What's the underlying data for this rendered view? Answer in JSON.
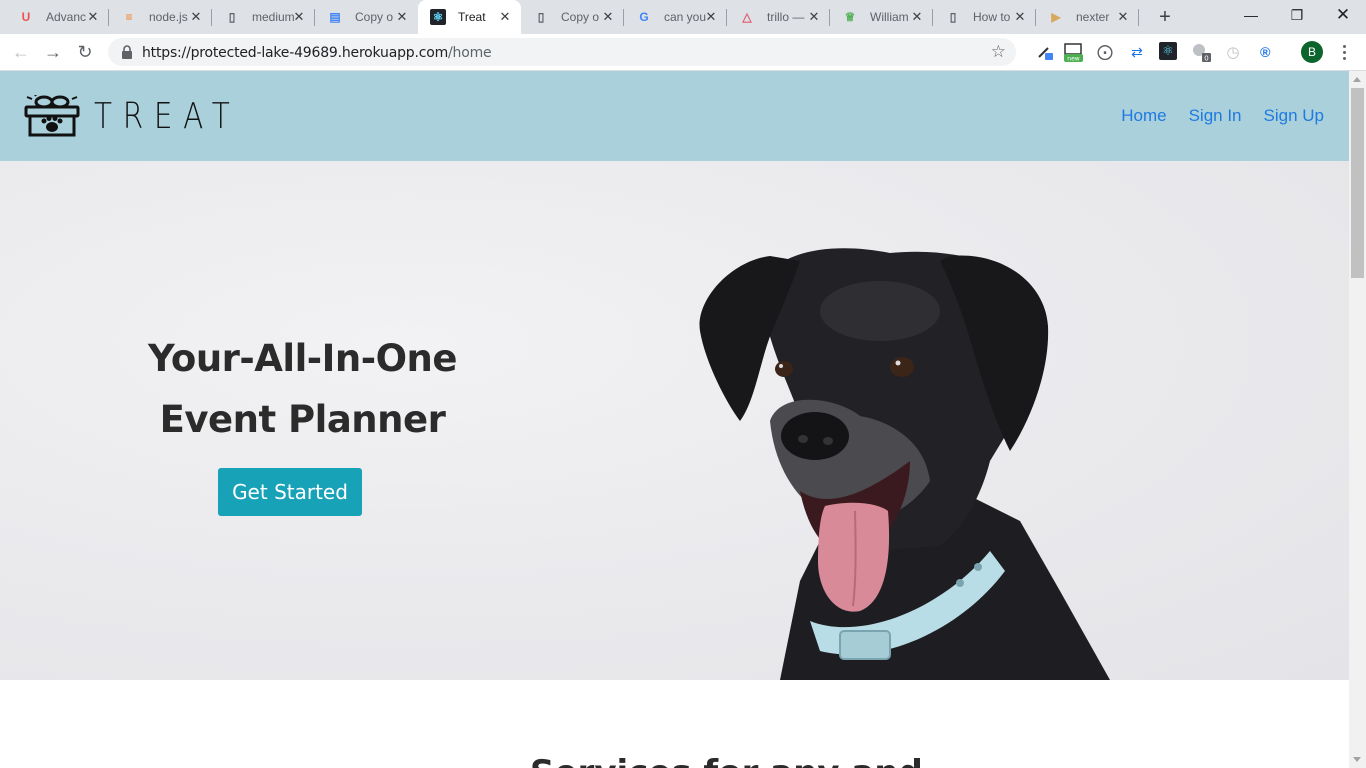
{
  "browser": {
    "tabs": [
      {
        "title": "Advanc",
        "icon": "udemy-icon",
        "color": "#ec5252"
      },
      {
        "title": "node.js",
        "icon": "stackoverflow-icon",
        "color": "#f48024"
      },
      {
        "title": "medium",
        "icon": "page-icon",
        "color": "#5f6368"
      },
      {
        "title": "Copy o",
        "icon": "google-docs-icon",
        "color": "#4285f4"
      },
      {
        "title": "Treat",
        "icon": "react-icon",
        "color": "#61dafb"
      },
      {
        "title": "Copy o",
        "icon": "page-icon",
        "color": "#5f6368"
      },
      {
        "title": "can you",
        "icon": "google-icon",
        "color": "#4285f4"
      },
      {
        "title": "trillo —",
        "icon": "triangle-icon",
        "color": "#e05b73"
      },
      {
        "title": "William",
        "icon": "crown-icon",
        "color": "#4caf50"
      },
      {
        "title": "How to",
        "icon": "page-icon",
        "color": "#5f6368"
      },
      {
        "title": "nexter",
        "icon": "play-icon",
        "color": "#d9a860"
      }
    ],
    "active_tab_index": 4,
    "url_host": "https://protected-lake-49689.herokuapp.com",
    "url_path": "/home",
    "profile_initial": "B",
    "extension_badge_new": "new",
    "extension_badge_count": "0"
  },
  "site": {
    "brand": "TREAT",
    "nav": {
      "home": "Home",
      "sign_in": "Sign In",
      "sign_up": "Sign Up"
    },
    "hero": {
      "title_line1": "Your-All-In-One",
      "title_line2": "Event Planner",
      "cta": "Get Started"
    },
    "next_section_heading": "Services for any and"
  },
  "colors": {
    "navbar_bg": "#aad1db",
    "link": "#1f7ae0",
    "cta_bg": "#17a2b8"
  }
}
